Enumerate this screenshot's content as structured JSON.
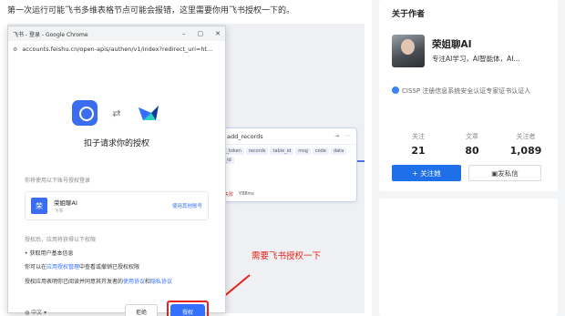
{
  "article": {
    "intro": "第一次运行可能飞书多维表格节点可能会报错，这里需要你用飞书授权一下的。",
    "hint": "需要飞书授权一下"
  },
  "workflow": {
    "node_title": "add_records",
    "chips": [
      "app_token",
      "records",
      "table_id",
      "msg",
      "code",
      "data",
      "log_id"
    ],
    "status": "运行失败",
    "status_detail": "Y88ms"
  },
  "browser": {
    "title": "飞书 - 登录 - Google Chrome",
    "url": "accounts.feishu.cn/open-apis/authen/v1/index?redirect_uri=ht..."
  },
  "auth": {
    "title": "扣子请求你的授权",
    "account_label": "你将使用以下账号授权登录",
    "avatar_char": "荣",
    "account_name": "荣姐聊AI",
    "account_sub": "飞书",
    "switch_label": "使用其他账号",
    "perm_label": "授权后，应用将获得以下权限",
    "perm_item": "获取用户基本信息",
    "note1_prefix": "你可以在",
    "note1_link": "应用授权管理",
    "note1_suffix": "中查看或撤销已授权权限",
    "note2_prefix": "授权应用表明你已阅读并同意其开发者的",
    "note2_link1": "使用协议",
    "note2_mid": "和",
    "note2_link2": "隐私协议",
    "lang": "中文",
    "reject_label": "拒绝",
    "authorize_label": "授权"
  },
  "author": {
    "card_title": "关于作者",
    "name": "荣姐聊AI",
    "desc": "专注AI学习，AI智能体，AI...",
    "cert": "CISSP 注册信息系统安全认证专家证书认证人",
    "stats": [
      {
        "label": "关注",
        "value": "21"
      },
      {
        "label": "文章",
        "value": "80"
      },
      {
        "label": "关注者",
        "value": "1,089"
      }
    ],
    "follow_label": "+ 关注她",
    "message_label": "发私信"
  }
}
